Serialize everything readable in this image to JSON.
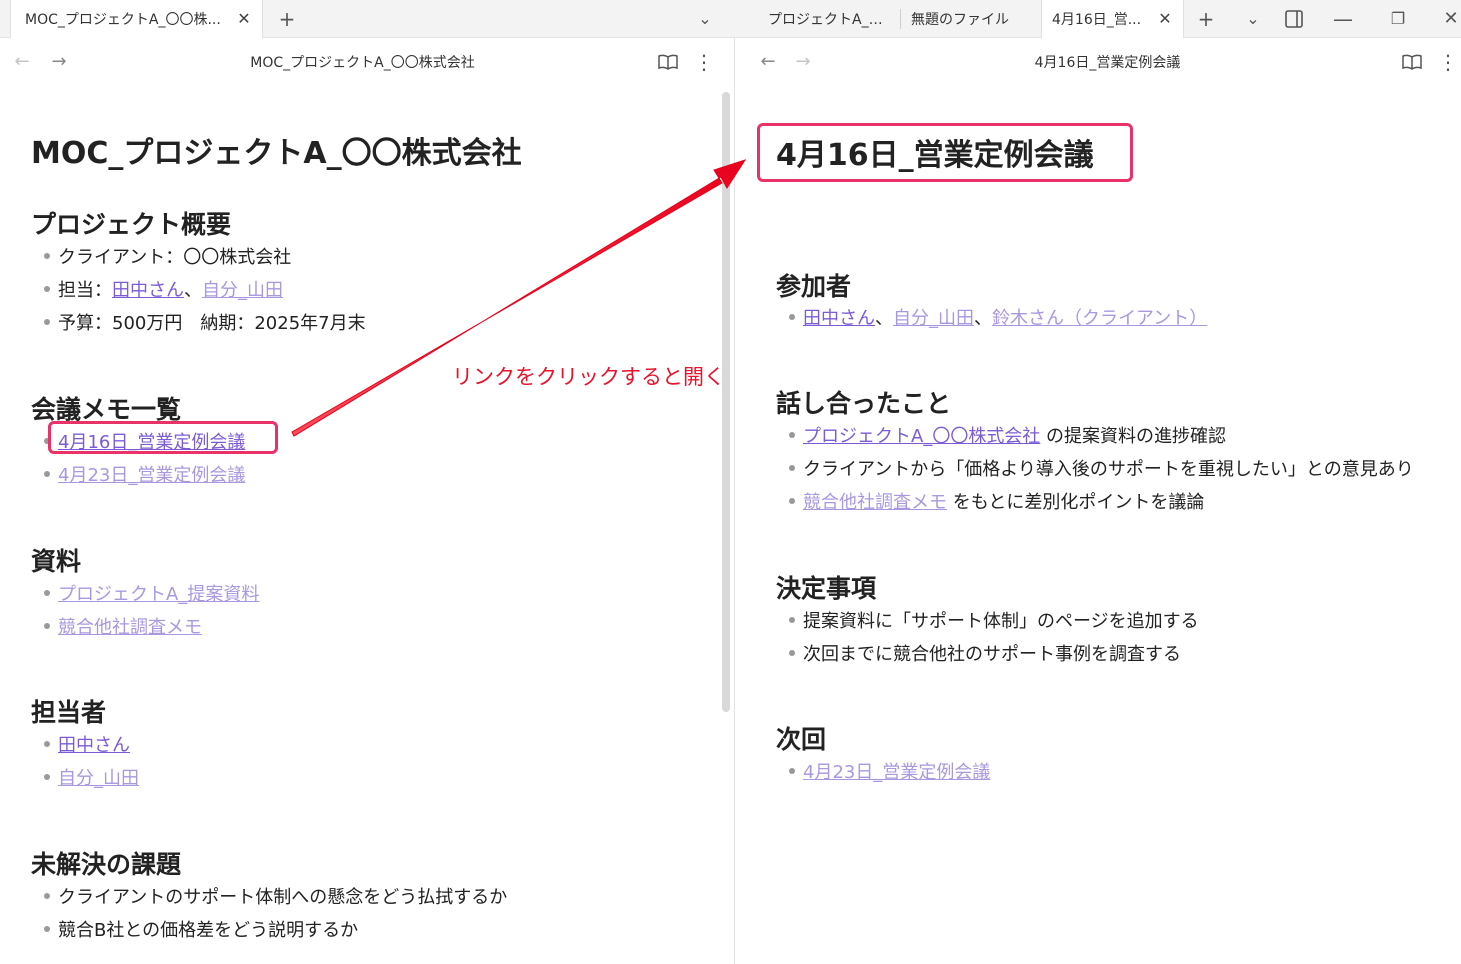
{
  "tabs": {
    "left_active": "MOC_プロジェクトA_〇〇株...",
    "right_tab_1": "プロジェクトA_〇...",
    "right_tab_2": "無題のファイル",
    "right_active": "4月16日_営..."
  },
  "left": {
    "pane_title": "MOC_プロジェクトA_〇〇株式会社",
    "doc_title": "MOC_プロジェクトA_〇〇株式会社",
    "overview": {
      "heading": "プロジェクト概要",
      "client": "クライアント：〇〇株式会社",
      "owner_label": "担当：",
      "owner_link_1": "田中さん",
      "sep": "、",
      "owner_link_2": "自分_山田",
      "budget": "予算：500万円　納期：2025年7月末"
    },
    "meetings": {
      "heading": "会議メモ一覧",
      "items": [
        "4月16日_営業定例会議",
        "4月23日_営業定例会議"
      ]
    },
    "materials": {
      "heading": "資料",
      "items": [
        "プロジェクトA_提案資料",
        "競合他社調査メモ"
      ]
    },
    "people": {
      "heading": "担当者",
      "items": [
        "田中さん",
        "自分_山田"
      ]
    },
    "issues": {
      "heading": "未解決の課題",
      "items": [
        "クライアントのサポート体制への懸念をどう払拭するか",
        "競合B社との価格差をどう説明するか"
      ]
    }
  },
  "right": {
    "pane_title": "4月16日_営業定例会議",
    "doc_title": "4月16日_営業定例会議",
    "attendees": {
      "heading": "参加者",
      "link_1": "田中さん",
      "sep": "、",
      "link_2": "自分_山田",
      "link_3": "鈴木さん（クライアント）"
    },
    "discussed": {
      "heading": "話し合ったこと",
      "item1_link": "プロジェクトA_〇〇株式会社",
      "item1_text": " の提案資料の進捗確認",
      "item2": "クライアントから「価格より導入後のサポートを重視したい」との意見あり",
      "item3_link": "競合他社調査メモ",
      "item3_text": " をもとに差別化ポイントを議論"
    },
    "decisions": {
      "heading": "決定事項",
      "items": [
        "提案資料に「サポート体制」のページを追加する",
        "次回までに競合他社のサポート事例を調査する"
      ]
    },
    "next": {
      "heading": "次回",
      "link": "4月23日_営業定例会議"
    }
  },
  "annotation": {
    "text": "リンクをクリックすると開く",
    "color": "#e8132b",
    "box_color": "#e83268"
  },
  "colors": {
    "link": "#7b5cd6",
    "link_faded": "#a998e0"
  }
}
